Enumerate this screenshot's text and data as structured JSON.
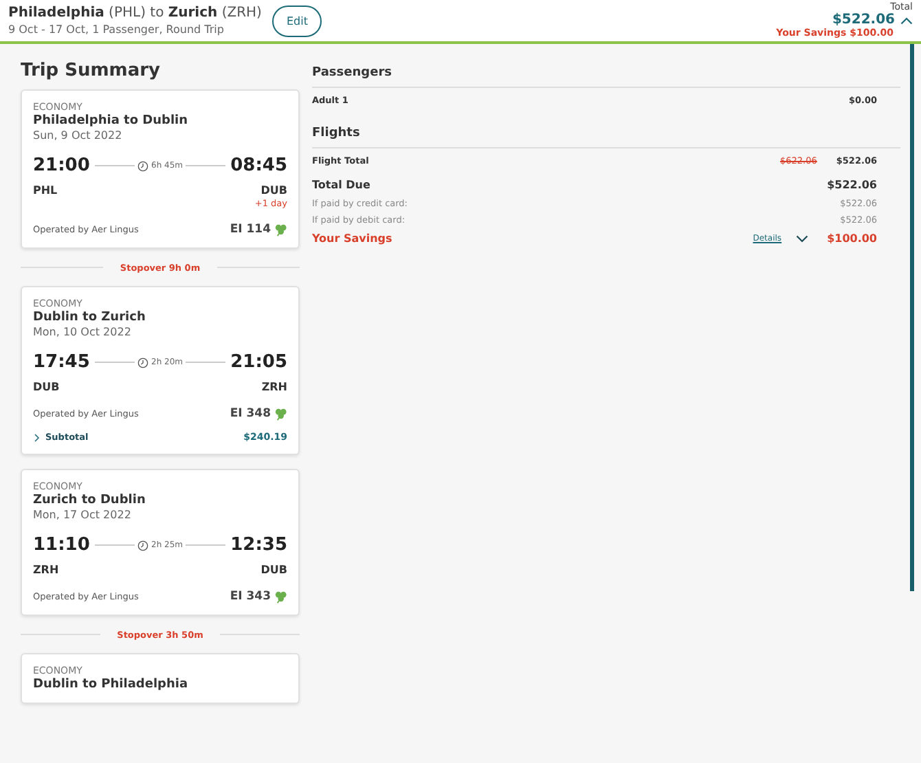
{
  "header": {
    "route": "**Philadelphia** (PHL) to **Zurich** (ZRH)",
    "details": "9 Oct - 17 Oct, 1 Passenger, Round Trip",
    "edit_button": "Edit",
    "total_label": "Total",
    "total": "$522.06",
    "savings": "Your Savings $100.00",
    "expanded": true
  },
  "trip_summary": {
    "title": "Trip Summary",
    "itinerary": [
      {
        "kind": "flight",
        "cabin": "ECONOMY",
        "route": "Philadelphia to Dublin",
        "date": "Sun, 9 Oct 2022",
        "dep_time": "21:00",
        "duration": "6h 45m",
        "arr_time": "08:45",
        "from": "PHL",
        "to": "DUB",
        "arrival_note": "+1 day",
        "operator": "Operated by Aer Lingus",
        "flight_no": "EI 114"
      },
      {
        "kind": "stopover",
        "label": "Stopover 9h 0m"
      },
      {
        "kind": "flight",
        "cabin": "ECONOMY",
        "route": "Dublin to Zurich",
        "date": "Mon, 10 Oct 2022",
        "dep_time": "17:45",
        "duration": "2h 20m",
        "arr_time": "21:05",
        "from": "DUB",
        "to": "ZRH",
        "operator": "Operated by Aer Lingus",
        "flight_no": "EI 348",
        "subtotal": {
          "label": "Subtotal",
          "amount": "$240.19",
          "expanded": false
        }
      },
      {
        "kind": "flight",
        "cabin": "ECONOMY",
        "route": "Zurich to Dublin",
        "date": "Mon, 17 Oct 2022",
        "dep_time": "11:10",
        "duration": "2h 25m",
        "arr_time": "12:35",
        "from": "ZRH",
        "to": "DUB",
        "operator": "Operated by Aer Lingus",
        "flight_no": "EI 343"
      },
      {
        "kind": "stopover",
        "label": "Stopover 3h 50m"
      },
      {
        "kind": "flight",
        "cabin": "ECONOMY",
        "route": "Dublin to Philadelphia"
      }
    ]
  },
  "price_sections": [
    {
      "heading": "Passengers",
      "rows": [
        {
          "kind": "line",
          "label": "Adult 1",
          "price": "$0.00"
        }
      ]
    },
    {
      "heading": "Flights",
      "rows": [
        {
          "kind": "line",
          "label": "Flight Total",
          "old_price": "$622.06",
          "price": "$522.06"
        },
        {
          "kind": "total",
          "label": "Total Due",
          "price": "$522.06"
        },
        {
          "kind": "note",
          "label": "If paid by credit card:",
          "price": "$522.06"
        },
        {
          "kind": "note",
          "label": "If paid by debit card:",
          "price": "$522.06"
        },
        {
          "kind": "savings",
          "label": "Your Savings",
          "link": "Details",
          "expanded": false,
          "price": "$100.00"
        }
      ]
    }
  ]
}
